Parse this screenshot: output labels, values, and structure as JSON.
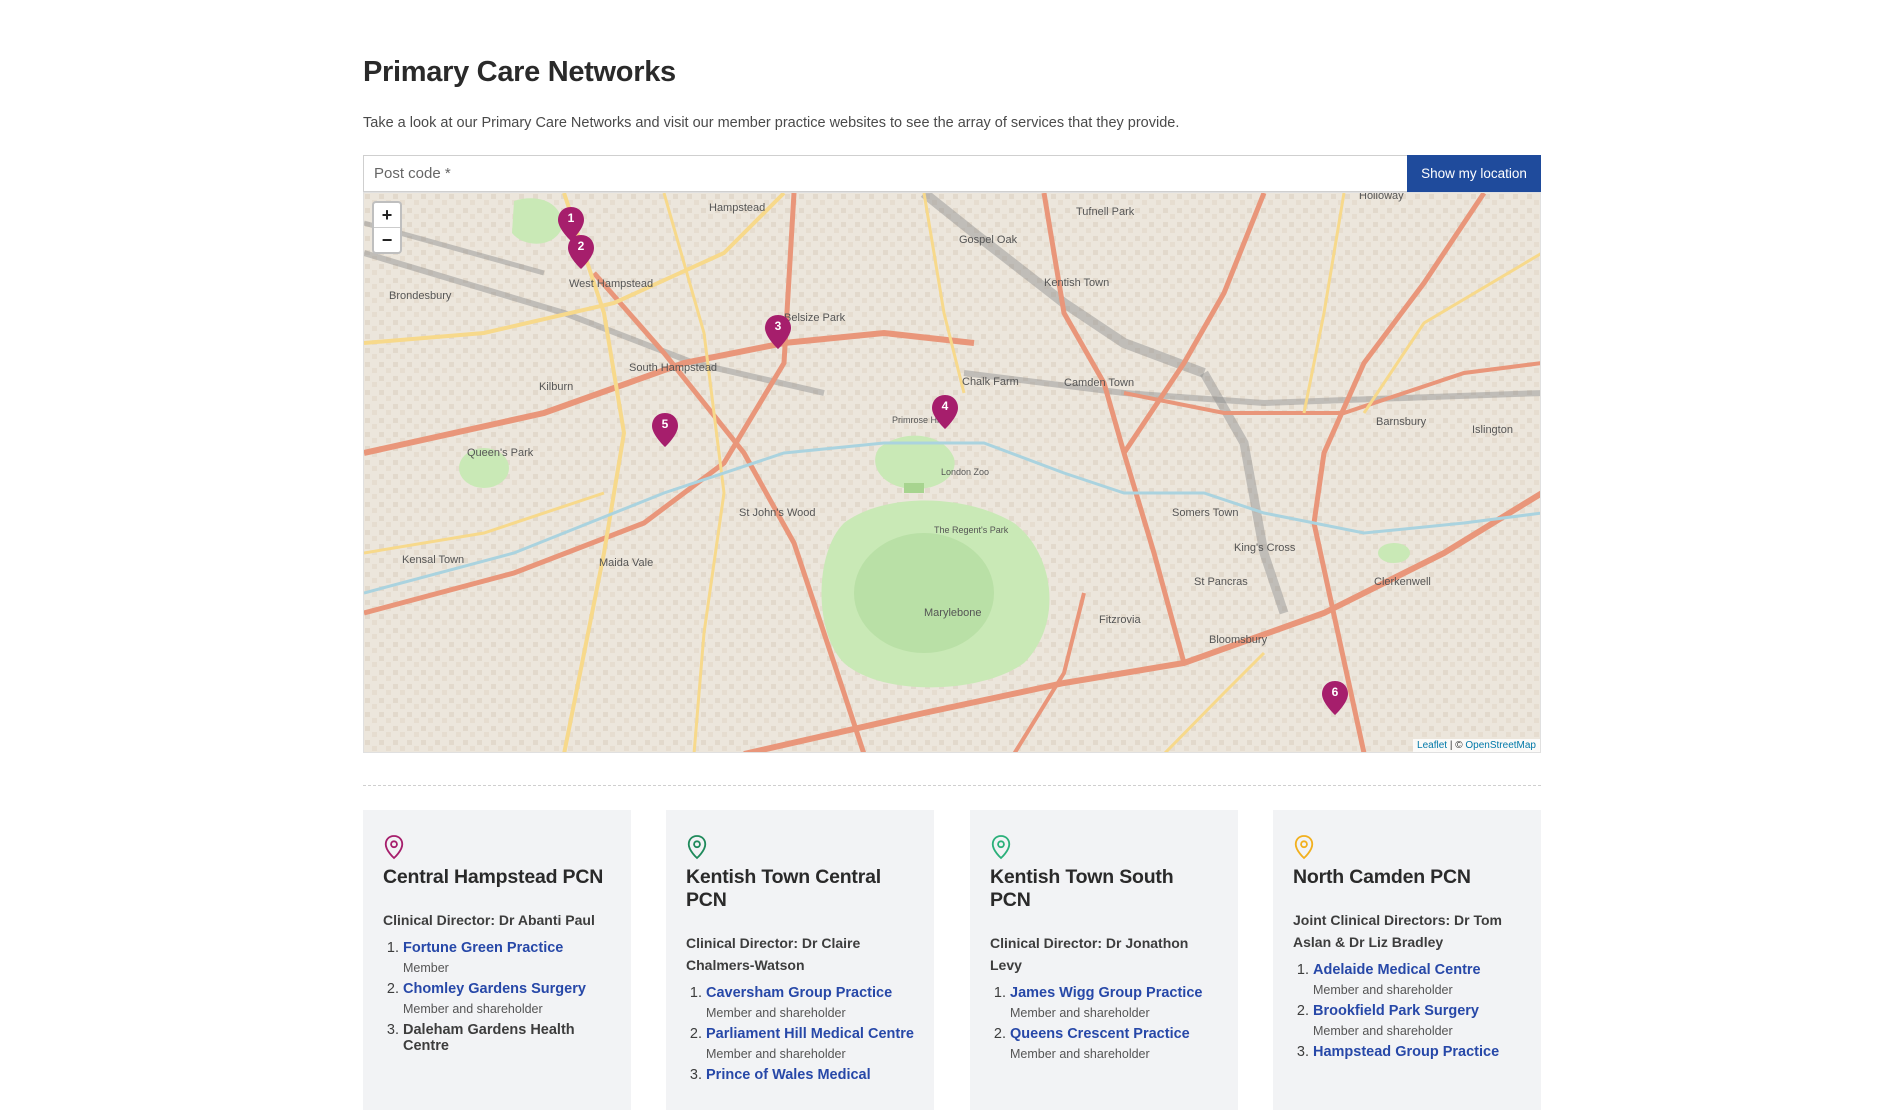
{
  "page": {
    "title": "Primary Care Networks",
    "intro": "Take a look at our Primary Care Networks and visit our member practice websites to see the array of services that they provide."
  },
  "search": {
    "placeholder": "Post code *",
    "value": "",
    "button_label": "Show my location"
  },
  "map": {
    "zoom_in": "+",
    "zoom_out": "−",
    "attribution_leaflet": "Leaflet",
    "attribution_separator": " | © ",
    "attribution_osm": "OpenStreetMap",
    "place_labels": [
      "Hampstead",
      "West Hampstead",
      "Belsize Park",
      "South Hampstead",
      "Kilburn",
      "Camden Town",
      "Chalk Farm",
      "Queen's Park",
      "St John's Wood",
      "Maida Vale",
      "London Zoo",
      "The Regent's Park",
      "Somers Town",
      "King's Cross",
      "Islington",
      "Barnsbury",
      "Holloway",
      "Tufnell Park",
      "Kentish Town",
      "Gospel Oak",
      "Marylebone",
      "Fitzrovia",
      "Bloomsbury",
      "Clerkenwell",
      "Brondesbury",
      "Kensal Town",
      "St Pancras",
      "Primrose Hill"
    ],
    "marker_color": "#a61e6c",
    "markers": [
      {
        "label": "1"
      },
      {
        "label": "2"
      },
      {
        "label": "3"
      },
      {
        "label": "4"
      },
      {
        "label": "5"
      },
      {
        "label": "6"
      }
    ]
  },
  "cards": [
    {
      "icon": "map-pin-icon",
      "icon_color": "#a61e6c",
      "title": "Central Hampstead PCN",
      "director": "Clinical Director: Dr Abanti Paul",
      "practices": [
        {
          "name": "Fortune Green Practice",
          "role": "Member",
          "link": true
        },
        {
          "name": "Chomley Gardens Surgery",
          "role": "Member and shareholder",
          "link": true
        },
        {
          "name": "Daleham Gardens Health Centre",
          "role": "",
          "link": false
        }
      ]
    },
    {
      "icon": "map-pin-icon",
      "icon_color": "#1f8a5b",
      "title": "Kentish Town Central PCN",
      "director": "Clinical Director: Dr Claire Chalmers-Watson",
      "practices": [
        {
          "name": "Caversham Group Practice",
          "role": "Member and shareholder",
          "link": true
        },
        {
          "name": "Parliament Hill Medical Centre",
          "role": "Member and shareholder",
          "link": true
        },
        {
          "name": "Prince of Wales Medical",
          "role": "",
          "link": true
        }
      ]
    },
    {
      "icon": "map-pin-icon",
      "icon_color": "#2bb07a",
      "title": "Kentish Town South PCN",
      "director": "Clinical Director: Dr Jonathon Levy",
      "practices": [
        {
          "name": "James Wigg Group Practice",
          "role": "Member and shareholder",
          "link": true
        },
        {
          "name": "Queens Crescent Practice",
          "role": "Member and shareholder",
          "link": true
        }
      ]
    },
    {
      "icon": "map-pin-icon",
      "icon_color": "#f2b01e",
      "title": "North Camden PCN",
      "director": "Joint Clinical Directors: Dr Tom Aslan & Dr Liz Bradley",
      "practices": [
        {
          "name": "Adelaide Medical Centre",
          "role": "Member and shareholder",
          "link": true
        },
        {
          "name": "Brookfield Park Surgery",
          "role": "Member and shareholder",
          "link": true
        },
        {
          "name": "Hampstead Group Practice",
          "role": "",
          "link": true
        }
      ]
    }
  ]
}
